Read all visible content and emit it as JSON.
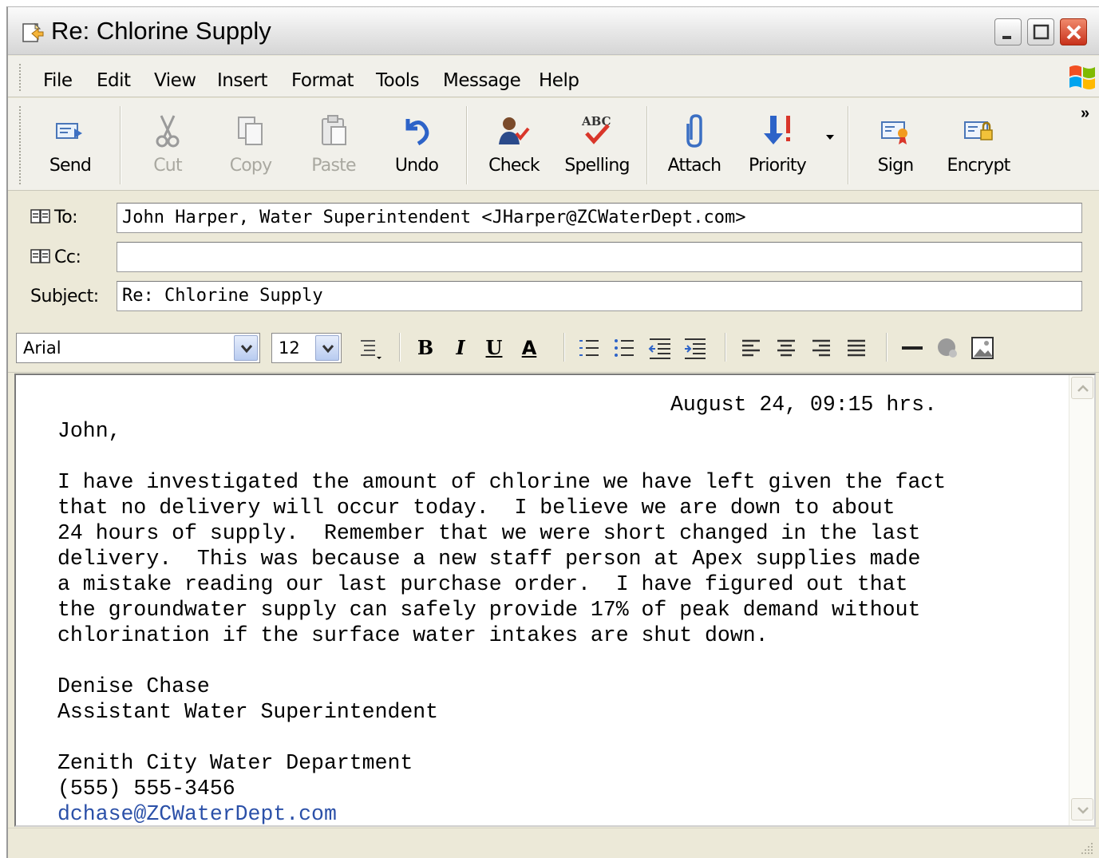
{
  "window": {
    "title": "Re: Chlorine Supply"
  },
  "menu": [
    "File",
    "Edit",
    "View",
    "Insert",
    "Format",
    "Tools",
    "Message",
    "Help"
  ],
  "toolbar": {
    "send": "Send",
    "cut": "Cut",
    "copy": "Copy",
    "paste": "Paste",
    "undo": "Undo",
    "check": "Check",
    "spelling": "Spelling",
    "attach": "Attach",
    "priority": "Priority",
    "sign": "Sign",
    "encrypt": "Encrypt",
    "more": "»",
    "spelling_icon_text": "ABC"
  },
  "headers": {
    "to_label": "To:",
    "to_value": "John Harper, Water Superintendent <JHarper@ZCWaterDept.com>",
    "cc_label": "Cc:",
    "cc_value": "",
    "subject_label": "Subject:",
    "subject_value": "Re: Chlorine Supply"
  },
  "format": {
    "font": "Arial",
    "size": "12",
    "bold": "B",
    "italic": "I",
    "underline": "U",
    "color": "A"
  },
  "message": {
    "dateline": "August 24, 09:15 hrs.",
    "greeting": "John,",
    "paragraph": [
      "I have investigated the amount of chlorine we have left given the fact",
      "that no delivery will occur today.  I believe we are down to about",
      "24 hours of supply.  Remember that we were short changed in the last",
      "delivery.  This was because a new staff person at Apex supplies made",
      "a mistake reading our last purchase order.  I have figured out that",
      "the groundwater supply can safely provide 17% of peak demand without",
      "chlorination if the surface water intakes are shut down."
    ],
    "sig_name": "Denise Chase",
    "sig_title": "Assistant Water Superintendent",
    "sig_org": "Zenith City Water Department",
    "sig_phone": "(555) 555-3456",
    "sig_email": "dchase@ZCWaterDept.com"
  },
  "colors": {
    "link": "#2b50a8",
    "close_button": "#c8311b",
    "window_bg": "#ece9d8"
  }
}
